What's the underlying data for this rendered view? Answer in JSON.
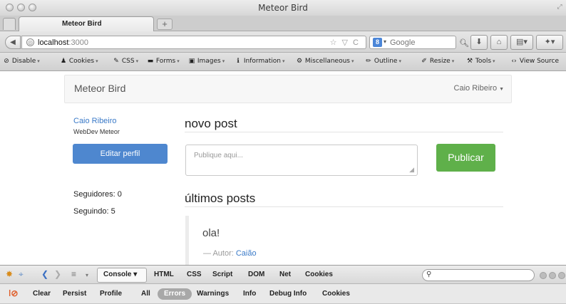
{
  "window": {
    "title": "Meteor Bird"
  },
  "tabs": {
    "active_label": "Meteor Bird",
    "new_tab_symbol": "+"
  },
  "navbar": {
    "url_host": "localhost",
    "url_port": ":3000",
    "url_actions": "☆ ▽ C",
    "search_engine_letter": "8",
    "search_placeholder": "Google"
  },
  "dev_toolbar": {
    "items": [
      "Disable",
      "Cookies",
      "CSS",
      "Forms",
      "Images",
      "Information",
      "Miscellaneous",
      "Outline",
      "Resize",
      "Tools",
      "View Source"
    ]
  },
  "app": {
    "brand": "Meteor Bird",
    "user_menu": "Caio Ribeiro",
    "profile": {
      "name": "Caio Ribeiro",
      "subtitle": "WebDev Meteor"
    },
    "edit_button": "Editar perfil",
    "followers": "Seguidores: 0",
    "following": "Seguindo: 5",
    "new_post_heading": "novo post",
    "post_placeholder": "Publique aqui...",
    "publish_button": "Publicar",
    "latest_heading": "últimos posts",
    "posts": [
      {
        "text": "ola!",
        "author_prefix": "— Autor:",
        "author": "Caião"
      }
    ]
  },
  "firebug": {
    "tabs": [
      "Console",
      "HTML",
      "CSS",
      "Script",
      "DOM",
      "Net",
      "Cookies"
    ],
    "filters": [
      "Clear",
      "Persist",
      "Profile",
      "All",
      "Errors",
      "Warnings",
      "Info",
      "Debug Info",
      "Cookies"
    ]
  }
}
